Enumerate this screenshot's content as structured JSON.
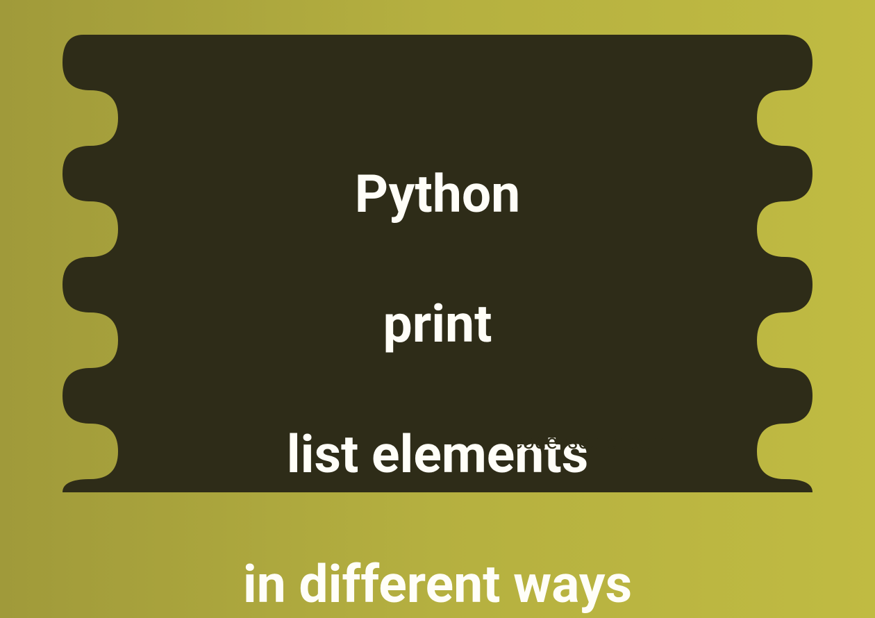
{
  "title": {
    "line1": "Python",
    "line2": "print",
    "line3": "list elements",
    "line4": "in different ways"
  },
  "attribution": "codevscolor.com",
  "colors": {
    "background_left": "#a09a3a",
    "background_right": "#c0bb42",
    "blob": "#2e2c18",
    "text": "#fffef8"
  }
}
